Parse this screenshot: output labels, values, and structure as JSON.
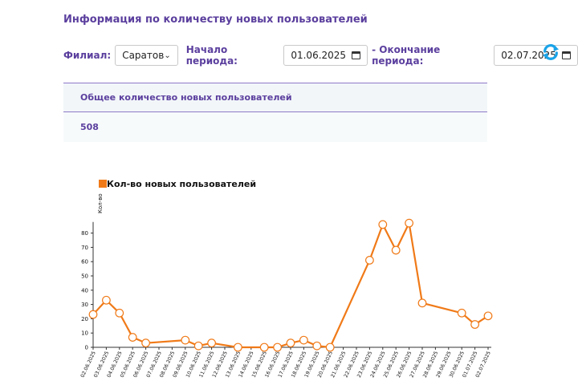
{
  "page": {
    "title": "Информация по количеству новых пользователей"
  },
  "filters": {
    "branch_label": "Филиал:",
    "branch_value": "Саратов",
    "start_label": "Начало периода:",
    "start_value": "01.06.2025",
    "end_label": "- Окончание периода:",
    "end_value": "02.07.2025"
  },
  "summary": {
    "header": "Общее количество новых пользователей",
    "value": "508"
  },
  "colors": {
    "accent": "#f07a18",
    "brand": "#5b3f9e",
    "refresh": "#1aa3e8"
  },
  "chart_data": {
    "type": "line",
    "legend": "Кол-во новых пользователей",
    "ylabel": "Кол-во",
    "ylim": [
      0,
      90
    ],
    "yticks": [
      0,
      10,
      20,
      30,
      40,
      50,
      60,
      70,
      80
    ],
    "categories": [
      "02.06.2025",
      "03.06.2025",
      "04.06.2025",
      "05.06.2025",
      "06.06.2025",
      "07.06.2025",
      "08.06.2025",
      "09.06.2025",
      "10.06.2025",
      "11.06.2025",
      "12.06.2025",
      "13.06.2025",
      "14.06.2025",
      "15.06.2025",
      "16.06.2025",
      "17.06.2025",
      "18.06.2025",
      "19.06.2025",
      "20.06.2025",
      "21.06.2025",
      "22.06.2025",
      "23.06.2025",
      "24.06.2025",
      "25.06.2025",
      "26.06.2025",
      "27.06.2025",
      "28.06.2025",
      "29.06.2025",
      "30.06.2025",
      "01.07.2025",
      "02.07.2025"
    ],
    "points": [
      {
        "x": "02.06.2025",
        "y": 23
      },
      {
        "x": "03.06.2025",
        "y": 33
      },
      {
        "x": "04.06.2025",
        "y": 24
      },
      {
        "x": "05.06.2025",
        "y": 7
      },
      {
        "x": "06.06.2025",
        "y": 3
      },
      {
        "x": "09.06.2025",
        "y": 5
      },
      {
        "x": "10.06.2025",
        "y": 1
      },
      {
        "x": "11.06.2025",
        "y": 3
      },
      {
        "x": "13.06.2025",
        "y": 0
      },
      {
        "x": "15.06.2025",
        "y": 0
      },
      {
        "x": "16.06.2025",
        "y": 0
      },
      {
        "x": "17.06.2025",
        "y": 3
      },
      {
        "x": "18.06.2025",
        "y": 5
      },
      {
        "x": "19.06.2025",
        "y": 1
      },
      {
        "x": "20.06.2025",
        "y": 0
      },
      {
        "x": "23.06.2025",
        "y": 61
      },
      {
        "x": "24.06.2025",
        "y": 86
      },
      {
        "x": "25.06.2025",
        "y": 68
      },
      {
        "x": "26.06.2025",
        "y": 87
      },
      {
        "x": "27.06.2025",
        "y": 31
      },
      {
        "x": "30.06.2025",
        "y": 24
      },
      {
        "x": "01.07.2025",
        "y": 16
      },
      {
        "x": "02.07.2025",
        "y": 22
      }
    ]
  }
}
